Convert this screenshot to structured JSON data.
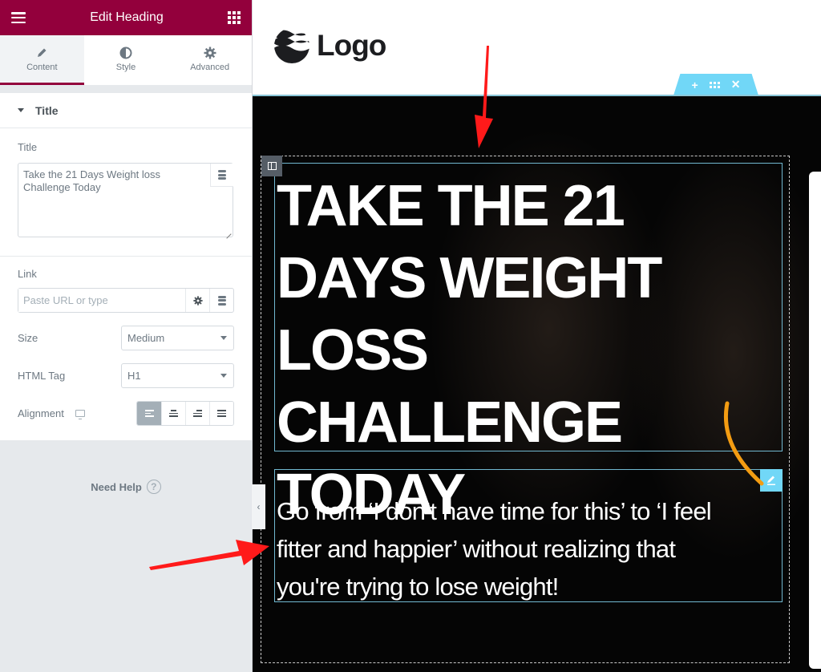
{
  "panel": {
    "header_title": "Edit Heading",
    "tabs": [
      {
        "label": "Content",
        "icon": "pencil-icon",
        "active": true
      },
      {
        "label": "Style",
        "icon": "half-circle-icon",
        "active": false
      },
      {
        "label": "Advanced",
        "icon": "gear-icon",
        "active": false
      }
    ],
    "section_title": "Title",
    "title_label": "Title",
    "title_value": "Take the 21 Days Weight loss Challenge Today",
    "link_label": "Link",
    "link_placeholder": "Paste URL or type",
    "size_label": "Size",
    "size_value": "Medium",
    "tag_label": "HTML Tag",
    "tag_value": "H1",
    "alignment_label": "Alignment",
    "alignment_options": [
      "left",
      "center",
      "right",
      "justify"
    ],
    "alignment_selected": "left",
    "need_help": "Need Help",
    "help_glyph": "?",
    "collapse_glyph": "‹"
  },
  "preview": {
    "logo_text": "Logo",
    "section_handle": {
      "add": "+",
      "close": "✕"
    },
    "heading": "TAKE THE 21 DAYS WEIGHT LOSS CHALLENGE TODAY",
    "text": "Go from ‘I don’t have time for this’ to ‘I feel fitter and happier’ without realizing that you're trying to lose weight!"
  },
  "colors": {
    "brand": "#93003c",
    "handle": "#71d7f7",
    "annotation_arrow": "#ff1a1a",
    "annotation_curve": "#f39c12"
  }
}
